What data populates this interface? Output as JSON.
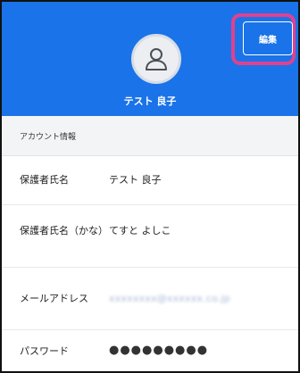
{
  "profile": {
    "name": "テスト 良子",
    "avatar_icon": "user-icon",
    "edit_label": "編集"
  },
  "colors": {
    "header_blue": "#1a73e8",
    "highlight_pink": "#e0418f"
  },
  "account_info": {
    "section_title": "アカウント情報",
    "rows": [
      {
        "label": "保護者氏名",
        "value": "テスト 良子"
      },
      {
        "label": "保護者氏名（かな）",
        "value": "てすと よしこ"
      },
      {
        "label": "メールアドレス",
        "value": "xxxxxxxx@xxxxxx.co.jp"
      },
      {
        "label": "パスワード",
        "value": "●●●●●●●●●"
      }
    ]
  }
}
